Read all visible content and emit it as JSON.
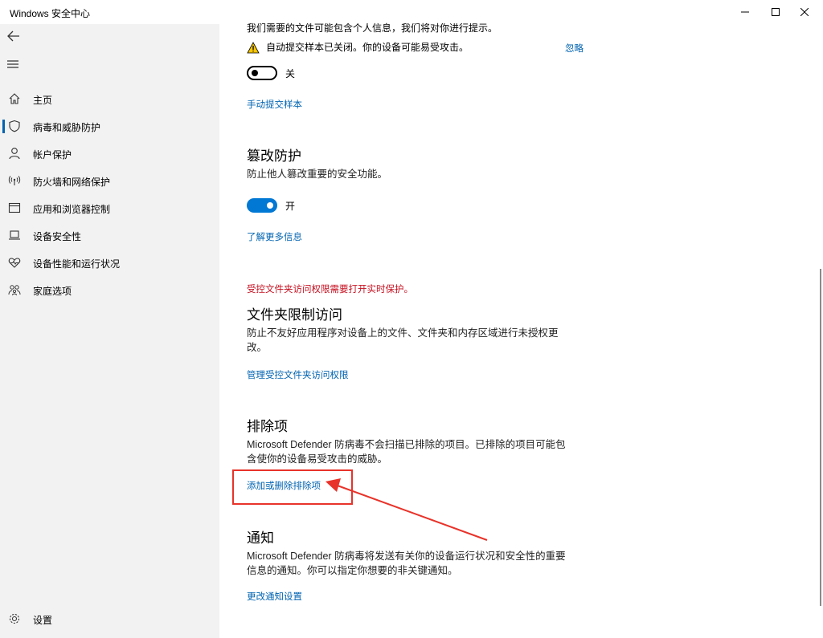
{
  "window": {
    "title": "Windows 安全中心"
  },
  "sidebar": {
    "items": [
      {
        "label": "主页",
        "icon": "home-icon"
      },
      {
        "label": "病毒和威胁防护",
        "icon": "shield-icon",
        "active": true
      },
      {
        "label": "帐户保护",
        "icon": "person-icon"
      },
      {
        "label": "防火墙和网络保护",
        "icon": "wireless-icon"
      },
      {
        "label": "应用和浏览器控制",
        "icon": "browser-window-icon"
      },
      {
        "label": "设备安全性",
        "icon": "laptop-icon"
      },
      {
        "label": "设备性能和运行状况",
        "icon": "heart-pulse-icon"
      },
      {
        "label": "家庭选项",
        "icon": "family-icon"
      }
    ],
    "settings_label": "设置"
  },
  "main": {
    "sample": {
      "desc": "我们需要的文件可能包含个人信息，我们将对你进行提示。",
      "warning_text": "自动提交样本已关闭。你的设备可能易受攻击。",
      "dismiss_label": "忽略",
      "toggle_state": "off",
      "toggle_label": "关",
      "link_label": "手动提交样本"
    },
    "tamper": {
      "heading": "篡改防护",
      "desc": "防止他人篡改重要的安全功能。",
      "toggle_state": "on",
      "toggle_label": "开",
      "link_label": "了解更多信息"
    },
    "folder_access": {
      "warning": "受控文件夹访问权限需要打开实时保护。",
      "heading": "文件夹限制访问",
      "desc_line1": "防止不友好应用程序对设备上的文件、文件夹和内存区域进行未授权更",
      "desc_line2": "改。",
      "link_label": "管理受控文件夹访问权限"
    },
    "exclusions": {
      "heading": "排除项",
      "desc_line1": "Microsoft Defender 防病毒不会扫描已排除的项目。已排除的项目可能包",
      "desc_line2": "含使你的设备易受攻击的威胁。",
      "link_label": "添加或删除排除项"
    },
    "notifications": {
      "heading": "通知",
      "desc_line1": "Microsoft Defender 防病毒将发送有关你的设备运行状况和安全性的重要",
      "desc_line2": "信息的通知。你可以指定你想要的非关键通知。",
      "link_label": "更改通知设置"
    }
  },
  "colors": {
    "accent": "#0063b1",
    "toggle_on": "#0078d4",
    "warning_red": "#c50f1f",
    "annotation_red": "#e8332a",
    "sidebar_bg": "#f2f2f2"
  }
}
